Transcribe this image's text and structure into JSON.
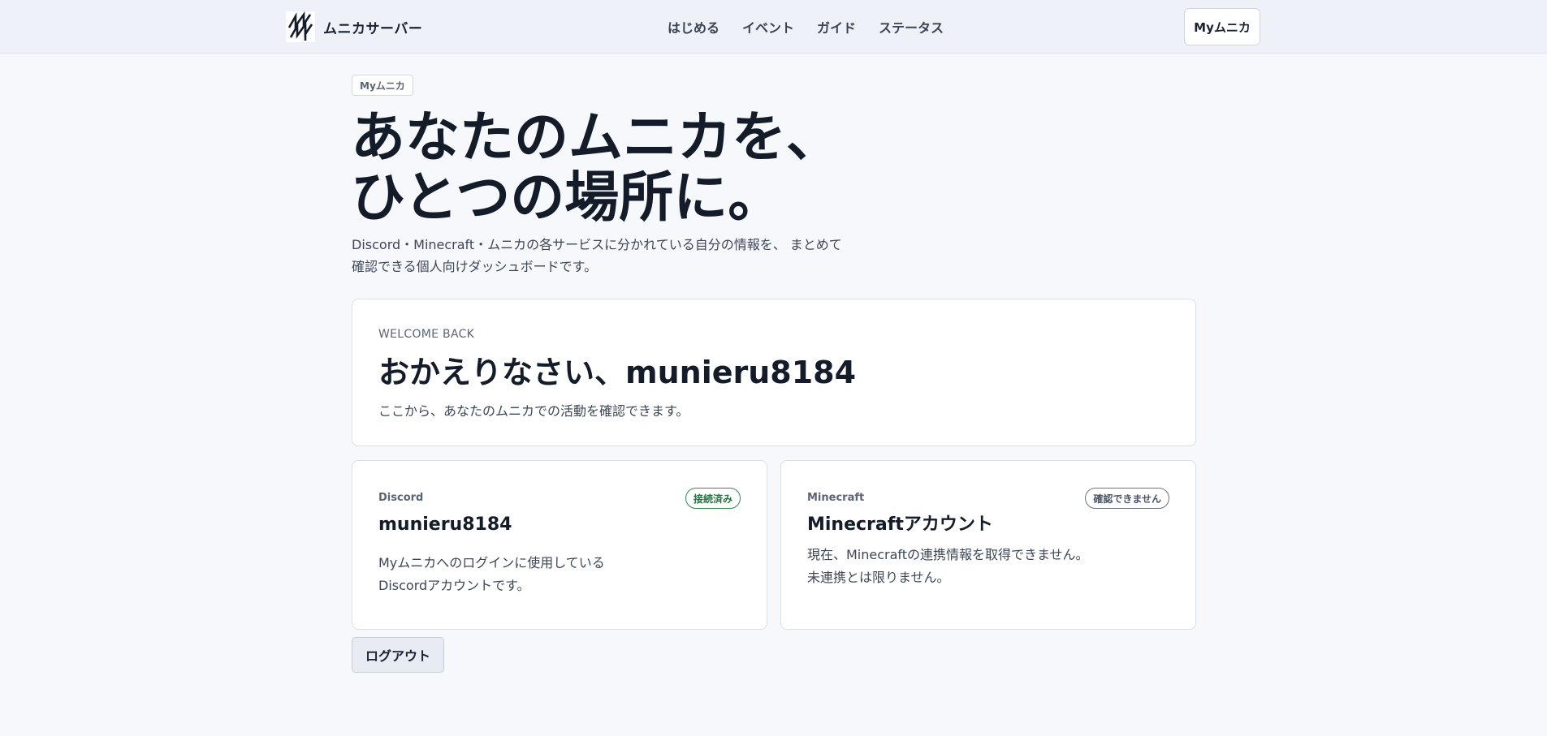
{
  "header": {
    "brand_name": "ムニカサーバー",
    "logo_icon": "munica-logo-icon",
    "nav": [
      {
        "label": "はじめる"
      },
      {
        "label": "イベント"
      },
      {
        "label": "ガイド"
      },
      {
        "label": "ステータス"
      }
    ],
    "account_button": "Myムニカ"
  },
  "hero": {
    "badge": "Myムニカ",
    "title_line1": "あなたのムニカを、",
    "title_line2": "ひとつの場所に。",
    "description_line1": "Discord・Minecraft・ムニカの各サービスに分かれている自分の情報を、 まとめて",
    "description_line2": "確認できる個人向けダッシュボードです。"
  },
  "welcome": {
    "eyebrow": "WELCOME BACK",
    "title": "おかえりなさい、munieru8184",
    "subtitle": "ここから、あなたのムニカでの活動を確認できます。"
  },
  "services": {
    "discord": {
      "label": "Discord",
      "status": "接続済み",
      "status_color": "#23753f",
      "title": "munieru8184",
      "description_line1": "Myムニカへのログインに使用している",
      "description_line2": "Discordアカウントです。"
    },
    "minecraft": {
      "label": "Minecraft",
      "status": "確認できません",
      "status_color": "#4c5565",
      "title": "Minecraftアカウント",
      "description_line1": "現在、Minecraftの連携情報を取得できません。",
      "description_line2": "未連携とは限りません。"
    }
  },
  "actions": {
    "logout": "ログアウト"
  },
  "colors": {
    "background": "#f6f8fb",
    "header_background": "#eef2f8",
    "text_primary": "#141b29",
    "connected": "#2f8a52"
  }
}
